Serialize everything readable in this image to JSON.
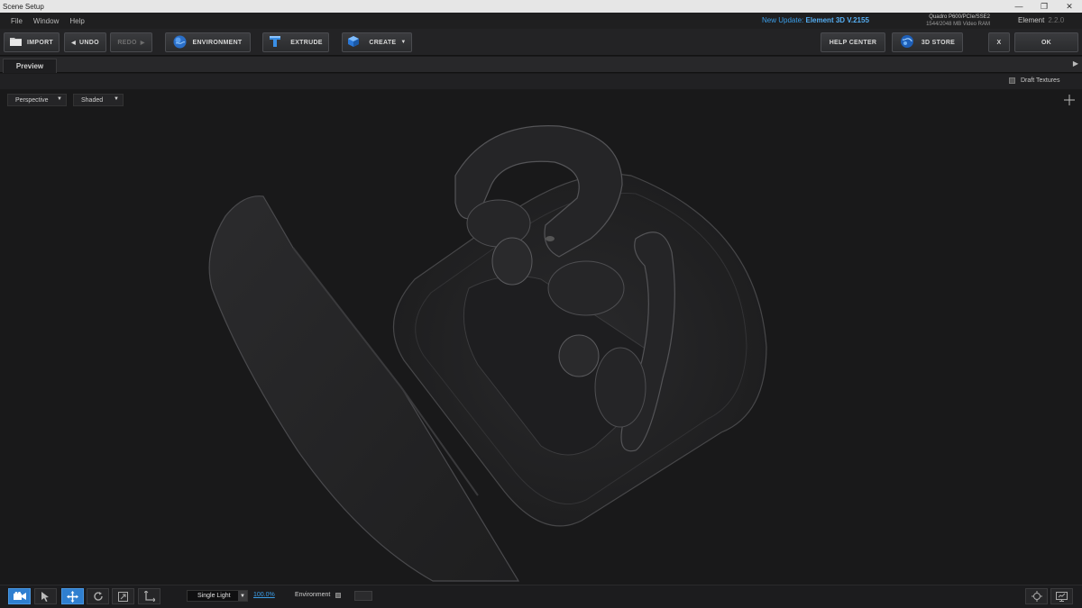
{
  "window": {
    "title": "Scene Setup",
    "controls": [
      "—",
      "❐",
      "✕"
    ]
  },
  "menu": {
    "items": [
      "File",
      "Window",
      "Help"
    ]
  },
  "status": {
    "update_prefix": "New Update:",
    "update_name": "Element 3D V.2155",
    "gpu_line1": "Quadro P600/PCIe/SSE2",
    "gpu_line2": "1544/2048 MB Video RAM",
    "plugin_name": "Element",
    "plugin_version": "2.2.0"
  },
  "toolbar": {
    "import_label": "IMPORT",
    "undo_label": "UNDO",
    "redo_label": "REDO",
    "environment_label": "ENVIRONMENT",
    "extrude_label": "EXTRUDE",
    "create_label": "CREATE",
    "help_center_label": "HELP CENTER",
    "store_label": "3D STORE",
    "cancel_label": "X",
    "ok_label": "OK"
  },
  "tabs": {
    "preview": "Preview",
    "expand_arrow": "▶"
  },
  "options": {
    "draft_textures": "Draft Textures",
    "draft_checked": false
  },
  "viewport": {
    "camera": "Perspective",
    "shading": "Shaded"
  },
  "bottom": {
    "light_mode": "Single Light",
    "intensity": "100.0%",
    "environment_label": "Environment",
    "active_tool": "camera"
  },
  "colors": {
    "accent": "#2f7fd0",
    "link": "#3b9ee8",
    "background": "#19191a"
  }
}
